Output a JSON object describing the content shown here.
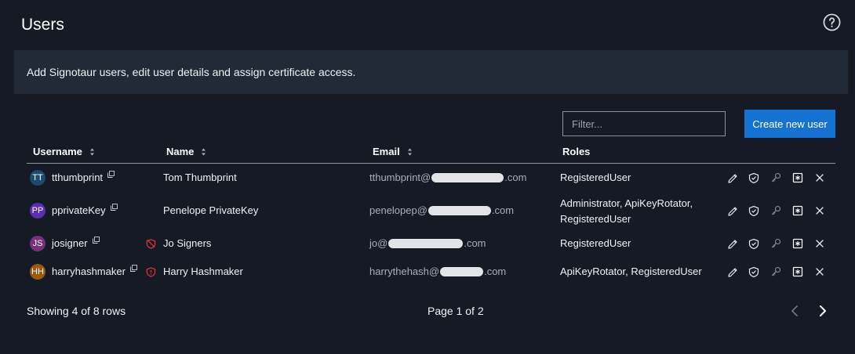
{
  "page": {
    "title": "Users",
    "description": "Add Signotaur users, edit user details and assign certificate access."
  },
  "toolbar": {
    "filter_placeholder": "Filter...",
    "create_label": "Create new user"
  },
  "table": {
    "headers": {
      "username": "Username",
      "name": "Name",
      "email": "Email",
      "roles": "Roles"
    },
    "rows": [
      {
        "initials": "TT",
        "avatar_color": "#1e4a6e",
        "username": "tthumbprint",
        "name": "Tom Thumbprint",
        "email_prefix": "tthumbprint@",
        "email_suffix": ".com",
        "roles_line1": "RegisteredUser",
        "roles_line2": "",
        "badge": "none"
      },
      {
        "initials": "PP",
        "avatar_color": "#5b2fb0",
        "username": "pprivateKey",
        "name": "Penelope PrivateKey",
        "email_prefix": "penelopep@",
        "email_suffix": ".com",
        "roles_line1": "Administrator, ApiKeyRotator,",
        "roles_line2": "RegisteredUser",
        "badge": "none"
      },
      {
        "initials": "JS",
        "avatar_color": "#7a2f7c",
        "username": "josigner",
        "name": "Jo Signers",
        "email_prefix": "jo@",
        "email_suffix": ".com",
        "roles_line1": "RegisteredUser",
        "roles_line2": "",
        "badge": "shield-off"
      },
      {
        "initials": "HH",
        "avatar_color": "#9a5a14",
        "username": "harryhashmaker",
        "name": "Harry Hashmaker",
        "email_prefix": "harrythehash@",
        "email_suffix": ".com",
        "roles_line1": "ApiKeyRotator, RegisteredUser",
        "roles_line2": "",
        "badge": "shield-alert"
      }
    ]
  },
  "footer": {
    "count": "Showing 4 of 8 rows",
    "page": "Page 1 of 2"
  },
  "colors": {
    "background": "#151a25",
    "banner": "#222a38",
    "accent": "#1572d3",
    "danger": "#e0353f"
  }
}
